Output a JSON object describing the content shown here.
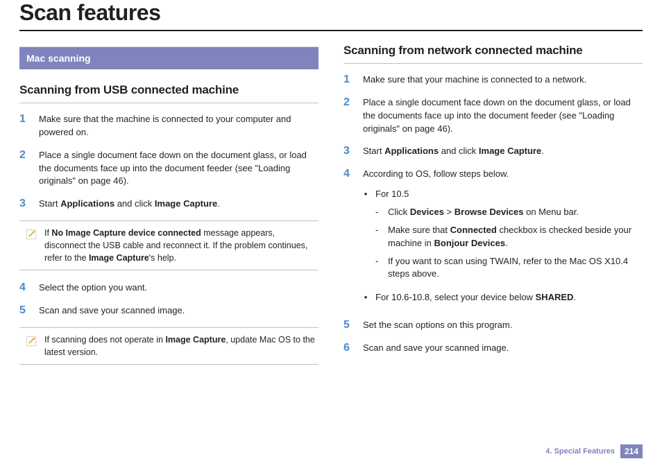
{
  "title": "Scan features",
  "left": {
    "sectionBar": "Mac scanning",
    "h2": "Scanning from USB connected machine",
    "steps": {
      "s1": {
        "n": "1",
        "t": "Make sure that the machine is connected to your computer and powered on."
      },
      "s2": {
        "n": "2",
        "t": "Place a single document face down on the document glass, or load the documents face up into the document feeder (see \"Loading originals\" on page 46)."
      },
      "s3": {
        "n": "3",
        "pre": "Start ",
        "b1": "Applications",
        "mid": " and click ",
        "b2": "Image Capture",
        "post": "."
      },
      "s4": {
        "n": "4",
        "t": "Select the option you want."
      },
      "s5": {
        "n": "5",
        "t": "Scan and save your scanned image."
      }
    },
    "note1": {
      "pre": "If ",
      "b1": "No Image Capture device connected",
      "mid": " message appears, disconnect the USB cable and reconnect it. If the problem continues, refer to the ",
      "b2": "Image Capture",
      "post": "'s help."
    },
    "note2": {
      "pre": "If scanning does not operate in ",
      "b1": "Image Capture",
      "post": ", update Mac OS to the latest version."
    }
  },
  "right": {
    "h2": "Scanning from network connected machine",
    "steps": {
      "s1": {
        "n": "1",
        "t": "Make sure that your machine is connected to a network."
      },
      "s2": {
        "n": "2",
        "t": "Place a single document face down on the document glass, or load the documents face up into the document feeder (see \"Loading originals\" on page 46)."
      },
      "s3": {
        "n": "3",
        "pre": "Start ",
        "b1": "Applications",
        "mid": " and click ",
        "b2": "Image Capture",
        "post": "."
      },
      "s4": {
        "n": "4",
        "t": "According to OS, follow steps below."
      },
      "s5": {
        "n": "5",
        "t": "Set the scan options on this program."
      },
      "s6": {
        "n": "6",
        "t": "Scan and save your scanned image."
      }
    },
    "os": {
      "for105": "For 10.5",
      "d1": {
        "pre": "Click ",
        "b1": "Devices",
        "mid": " > ",
        "b2": "Browse Devices",
        "post": " on Menu bar."
      },
      "d2": {
        "pre": "Make sure that ",
        "b1": "Connected",
        "mid": " checkbox is checked beside your machine in ",
        "b2": "Bonjour Devices",
        "post": "."
      },
      "d3": {
        "t": "If you want to scan using TWAIN, refer to the Mac OS X10.4 steps above."
      },
      "for106": {
        "pre": "For 10.6-10.8, select your device below ",
        "b1": "SHARED",
        "post": "."
      }
    }
  },
  "footer": {
    "chapter": "4.  Special Features",
    "page": "214"
  }
}
